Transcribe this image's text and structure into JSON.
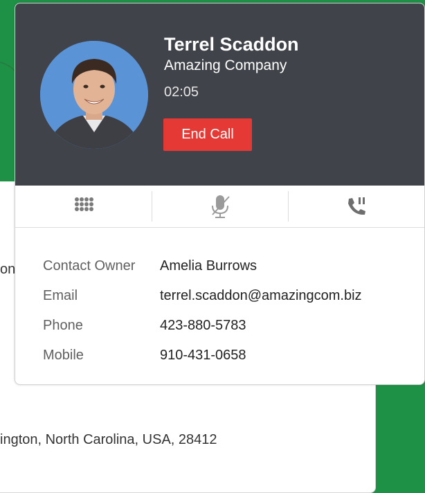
{
  "background": {
    "fragment_top": "on",
    "fragment_bottom": "ington, North Carolina, USA, 28412"
  },
  "caller": {
    "name": "Terrel Scaddon",
    "company": "Amazing Company",
    "timer": "02:05",
    "end_call_label": "End Call"
  },
  "toolbar": {
    "items": [
      {
        "icon": "dialpad-icon"
      },
      {
        "icon": "mic-muted-icon"
      },
      {
        "icon": "call-hold-icon"
      }
    ]
  },
  "details": [
    {
      "label": "Contact Owner",
      "value": "Amelia Burrows"
    },
    {
      "label": "Email",
      "value": "terrel.scaddon@amazingcom.biz"
    },
    {
      "label": "Phone",
      "value": "423-880-5783"
    },
    {
      "label": "Mobile",
      "value": "910-431-0658"
    }
  ],
  "colors": {
    "header_bg": "#41434a",
    "end_call": "#e53935",
    "background_green": "#1f9146",
    "icon_gray": "#7a7a7a"
  }
}
